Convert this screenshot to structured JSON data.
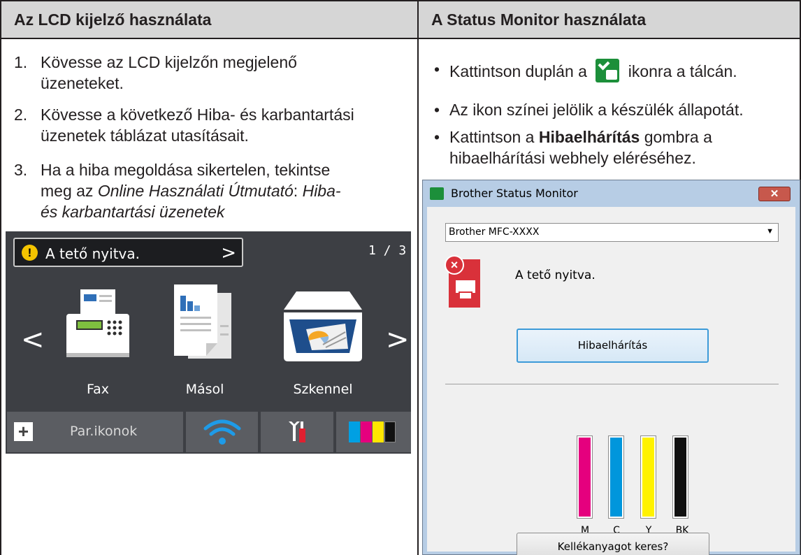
{
  "left": {
    "header": "Az LCD kijelző használata",
    "steps": [
      {
        "num": "1.",
        "line1": "Kövesse az LCD kijelzőn megjelenő",
        "line2": "üzeneteket."
      },
      {
        "num": "2.",
        "line1": "Kövesse a következő Hiba- és karbantartási",
        "line2": "üzenetek táblázat utasításait."
      },
      {
        "num": "3.",
        "line1": "Ha a hiba megoldása sikertelen, tekintse",
        "line2_pre": "meg az ",
        "line2_italic": "Online Használati Útmutató",
        "line2_mid": ": ",
        "line2_italic2": "Hiba-",
        "line3": "és karbantartási üzenetek"
      }
    ]
  },
  "lcd": {
    "message": "A tető nyitva.",
    "page": "1 / 3",
    "labels": [
      "Fax",
      "Másol",
      "Szkennel"
    ],
    "shortcuts": "Par.ikonok",
    "colors": {
      "cyan": "#00a0e3",
      "magenta": "#e5007e",
      "yellow": "#ffe600",
      "black": "#111111"
    }
  },
  "right": {
    "header": "A Status Monitor használata",
    "bullets": {
      "b1_pre": "Kattintson duplán a",
      "b1_post": "ikonra a tálcán.",
      "b2": "Az ikon színei jelölik a készülék állapotát.",
      "b3_pre": "Kattintson a ",
      "b3_bold": "Hibaelhárítás",
      "b3_post": " gombra a",
      "b3_line2": "hibaelhárítási webhely eléréséhez."
    }
  },
  "window": {
    "title": "Brother Status Monitor",
    "close": "✕",
    "model": "Brother MFC-XXXX",
    "status": "A tető nyitva.",
    "troubleshoot_button": "Hibaelhárítás",
    "ink_labels": [
      "M",
      "C",
      "Y",
      "BK"
    ],
    "ink_colors": [
      "#e5007e",
      "#0096dc",
      "#fff200",
      "#111111"
    ],
    "supplies_button": "Kellékanyagot keres?"
  }
}
